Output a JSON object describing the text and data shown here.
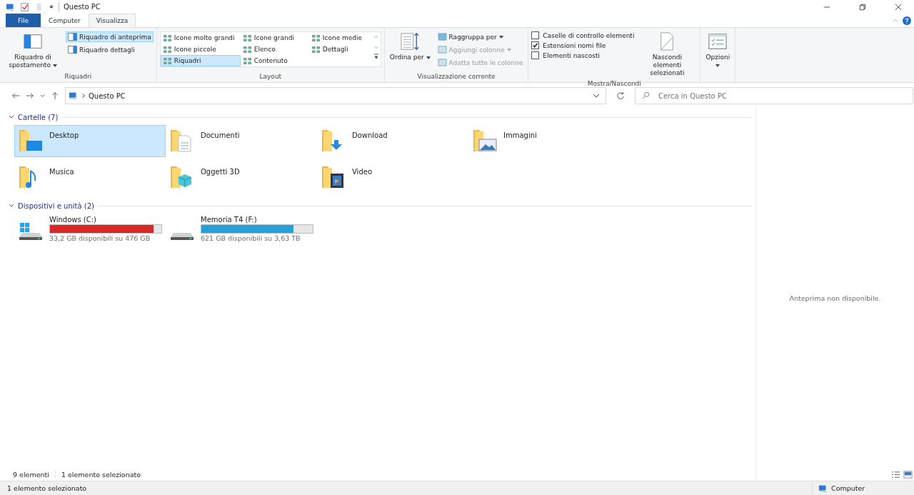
{
  "title_bar": {
    "title": "Questo PC"
  },
  "ribbon_tabs": [
    {
      "label": "File",
      "kind": "file",
      "selected": false
    },
    {
      "label": "Computer",
      "kind": "tab",
      "selected": false
    },
    {
      "label": "Visualizza",
      "kind": "tab",
      "selected": true
    }
  ],
  "panes_group": {
    "label": "Riquadri",
    "navigation_pane": "Riquadro di spostamento",
    "toggles": [
      {
        "label": "Riquadro di anteprima",
        "selected": true
      },
      {
        "label": "Riquadro dettagli",
        "selected": false
      }
    ]
  },
  "layout_group": {
    "label": "Layout",
    "options": [
      {
        "label": "Icone molto grandi",
        "selected": false
      },
      {
        "label": "Icone grandi",
        "selected": false
      },
      {
        "label": "Icone medie",
        "selected": false
      },
      {
        "label": "Icone piccole",
        "selected": false
      },
      {
        "label": "Elenco",
        "selected": false
      },
      {
        "label": "Dettagli",
        "selected": false
      },
      {
        "label": "Riquadri",
        "selected": true
      },
      {
        "label": "Contenuto",
        "selected": false
      }
    ]
  },
  "current_view_group": {
    "label": "Visualizzazione corrente",
    "sort_by": "Ordina per",
    "actions": [
      {
        "label": "Raggruppa per",
        "disabled": false
      },
      {
        "label": "Aggiungi colonne",
        "disabled": true
      },
      {
        "label": "Adatta tutte le colonne",
        "disabled": true
      }
    ]
  },
  "show_hide_group": {
    "label": "Mostra/Nascondi",
    "checkboxes": [
      {
        "label": "Caselle di controllo elementi",
        "checked": false
      },
      {
        "label": "Estensioni nomi file",
        "checked": true
      },
      {
        "label": "Elementi nascosti",
        "checked": false
      }
    ],
    "hide_selected": "Nascondi elementi selezionati"
  },
  "options_button": "Opzioni",
  "address_bar": {
    "path": "Questo PC"
  },
  "search": {
    "placeholder": "Cerca in Questo PC"
  },
  "sections": [
    {
      "title": "Cartelle (7)",
      "kind": "folders",
      "items": [
        {
          "name": "Desktop",
          "kind": "desktop",
          "selected": true
        },
        {
          "name": "Documenti",
          "kind": "documents",
          "selected": false
        },
        {
          "name": "Download",
          "kind": "downloads",
          "selected": false
        },
        {
          "name": "Immagini",
          "kind": "pictures",
          "selected": false
        },
        {
          "name": "Musica",
          "kind": "music",
          "selected": false
        },
        {
          "name": "Oggetti 3D",
          "kind": "objects",
          "selected": false
        },
        {
          "name": "Video",
          "kind": "videos",
          "selected": false
        }
      ]
    },
    {
      "title": "Dispositivi e unità (2)",
      "kind": "drives",
      "items": [
        {
          "name": "Windows (C:)",
          "kind": "system",
          "level": 0.93,
          "color": "#da2626",
          "free": "33,2 GB disponibili su 476 GB"
        },
        {
          "name": "Memoria T4 (F:)",
          "kind": "disk",
          "level": 0.83,
          "color": "#26a0da",
          "free": "621 GB disponibili su 3,63 TB"
        }
      ]
    }
  ],
  "preview_message": "Anteprima non disponibile.",
  "status_bar": {
    "count": "9 elementi",
    "selection": "1 elemento selezionato"
  },
  "details_bar": {
    "text": "1 elemento selezionato",
    "location": "Computer"
  }
}
